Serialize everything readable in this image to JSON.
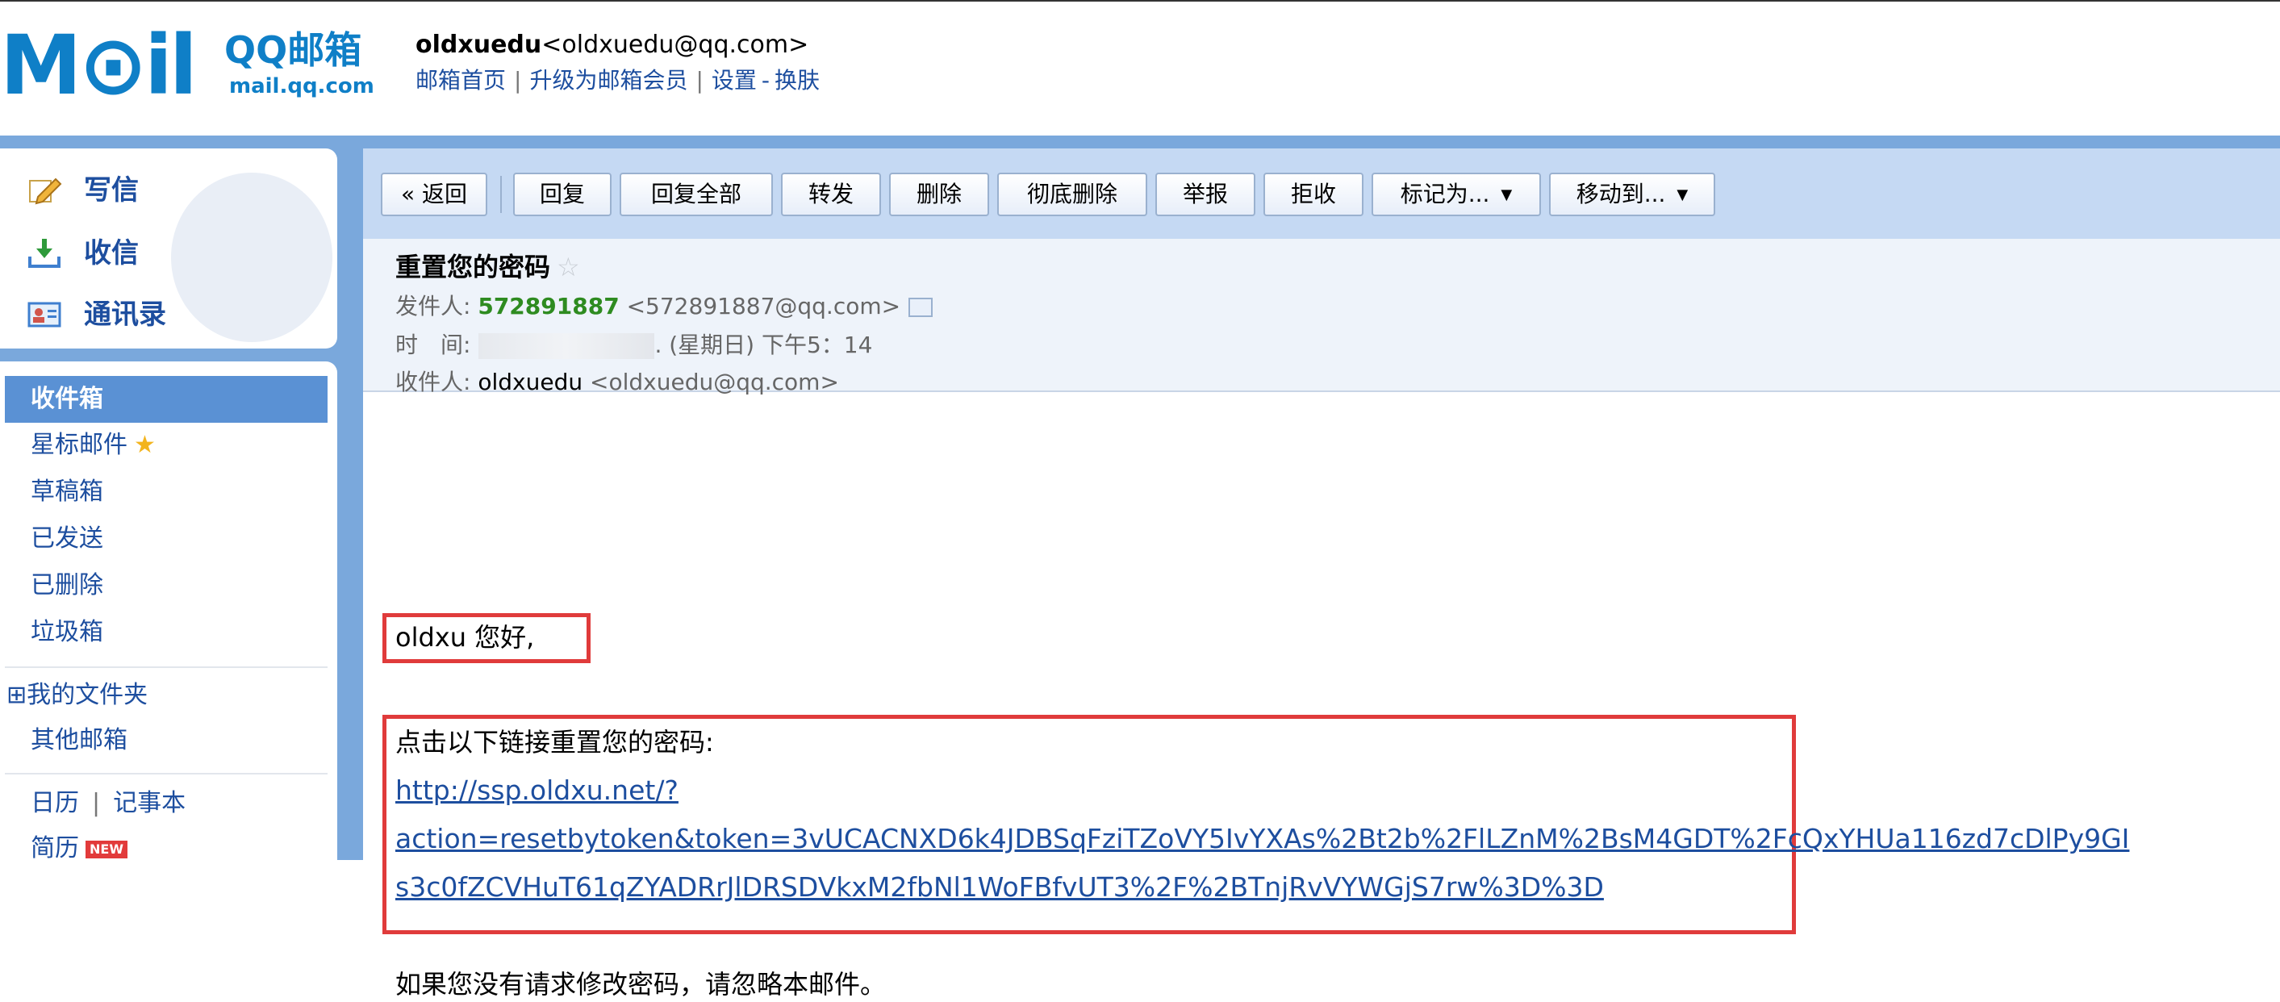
{
  "header": {
    "logo_letters": "M⊙il",
    "logo_title": "QQ邮箱",
    "logo_domain": "mail.qq.com",
    "username": "oldxuedu",
    "user_email": "<oldxuedu@qq.com>",
    "nav": {
      "home": "邮箱首页",
      "upgrade": "升级为邮箱会员",
      "settings": "设置",
      "dash": "-",
      "skin": "换肤"
    }
  },
  "sidebar": {
    "quick": {
      "compose": "写信",
      "receive": "收信",
      "contacts": "通讯录"
    },
    "folders": {
      "inbox": "收件箱",
      "starred": "星标邮件",
      "drafts": "草稿箱",
      "sent": "已发送",
      "deleted": "已删除",
      "spam": "垃圾箱",
      "my_folders": "⊞我的文件夹",
      "other_mailbox": "其他邮箱",
      "calendar": "日历",
      "sep": "|",
      "notes": "记事本",
      "resume": "简历",
      "new_badge": "NEW"
    }
  },
  "toolbar": {
    "back": "« 返回",
    "reply": "回复",
    "reply_all": "回复全部",
    "forward": "转发",
    "delete": "删除",
    "delete_permanent": "彻底删除",
    "report": "举报",
    "reject": "拒收",
    "mark_as": "标记为...",
    "move_to": "移动到...",
    "caret": "▼"
  },
  "mail": {
    "subject": "重置您的密码",
    "star": "☆",
    "from_label": "发件人:",
    "from_name": "572891887",
    "from_addr": "<572891887@qq.com>",
    "time_label": "时　间:",
    "time_value": ". (星期日) 下午5：14",
    "to_label": "收件人:",
    "to_name": "oldxuedu",
    "to_addr": "<oldxuedu@qq.com>"
  },
  "body": {
    "greeting": "oldxu 您好,",
    "instruction": "点击以下链接重置您的密码:",
    "link_line1": "http://ssp.oldxu.net/?",
    "link_line2": "action=resetbytoken&token=3vUCACNXD6k4JDBSqFziTZoVY5IvYXAs%2Bt2b%2FlLZnM%2BsM4GDT%2FcQxYHUa116zd7cDlPy9GI",
    "link_line3": "s3c0fZCVHuT61qZYADRrJlDRSDVkxM2fbNl1WoFBfvUT3%2F%2BTnjRvVYWGjS7rw%3D%3D",
    "ignore_note": "如果您没有请求修改密码，请忽略本邮件。"
  },
  "colors": {
    "brand_blue": "#0f7fc7",
    "link_blue": "#1d4e9f",
    "frame_blue": "#7aa8dc",
    "highlight_red": "#e03b3b",
    "sender_green": "#2e8b20"
  }
}
